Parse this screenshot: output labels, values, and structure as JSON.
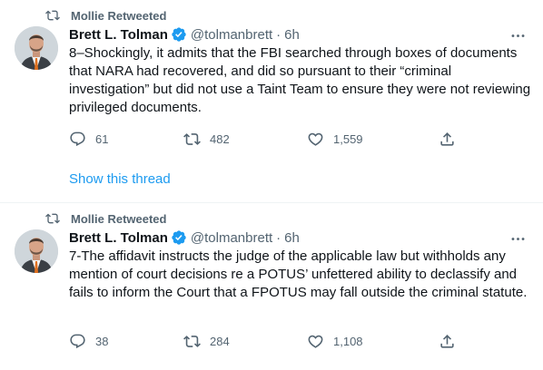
{
  "tweets": [
    {
      "retweeted_by": "Mollie Retweeted",
      "name": "Brett L. Tolman",
      "handle": "@tolmanbrett",
      "dot": "·",
      "time": "6h",
      "text": "8–Shockingly, it admits that the FBI searched through boxes of documents that NARA had recovered, and did so pursuant to their “criminal investigation” but did not use a Taint Team to ensure they were not reviewing privileged documents.",
      "replies": "61",
      "retweets": "482",
      "likes": "1,559",
      "show_thread": "Show this thread"
    },
    {
      "retweeted_by": "Mollie Retweeted",
      "name": "Brett L. Tolman",
      "handle": "@tolmanbrett",
      "dot": "·",
      "time": "6h",
      "text": "7-The affidavit instructs the judge of the applicable law but withholds any mention of court decisions re a POTUS’ unfettered ability to declassify and fails to inform the Court that a FPOTUS may fall outside the criminal statute.",
      "replies": "38",
      "retweets": "284",
      "likes": "1,108"
    }
  ],
  "colors": {
    "accent": "#1d9bf0",
    "muted": "#536471",
    "text": "#0f1419",
    "divider": "#eff3f4"
  }
}
